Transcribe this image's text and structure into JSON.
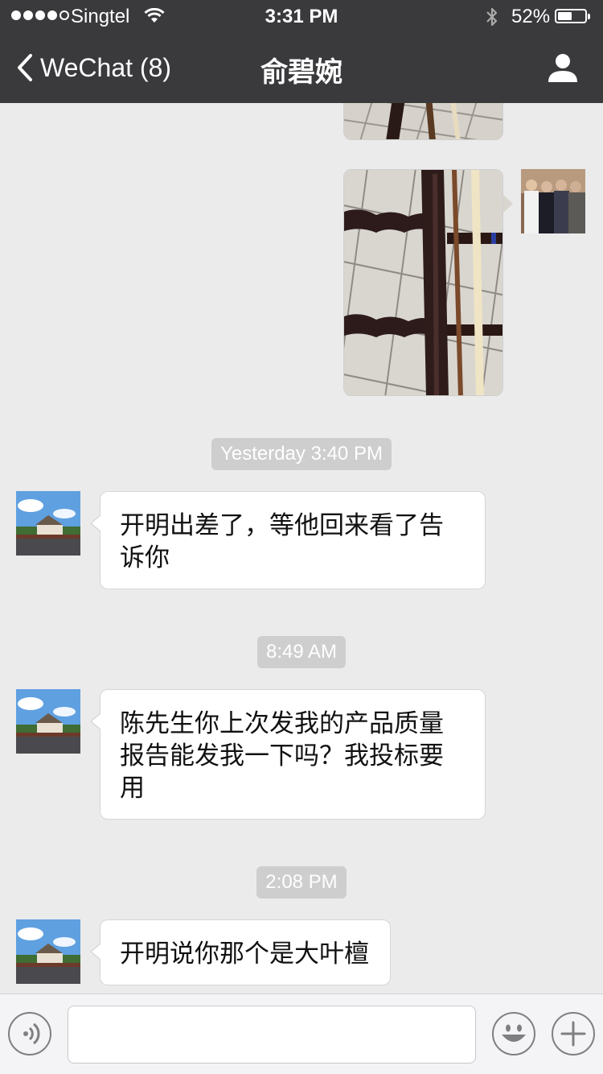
{
  "status_bar": {
    "carrier": "Singtel",
    "time": "3:31 PM",
    "battery_percent": "52%",
    "battery_level": 0.52,
    "signal_bars_filled": 4,
    "signal_bars_total": 5
  },
  "nav": {
    "back_label": "WeChat (8)",
    "title": "俞碧婉"
  },
  "messages": [
    {
      "type": "image",
      "direction": "outgoing",
      "description_icon": "photo-thumbnail"
    },
    {
      "type": "image",
      "direction": "outgoing",
      "description_icon": "photo-thumbnail"
    },
    {
      "type": "timestamp",
      "text": "Yesterday 3:40 PM"
    },
    {
      "type": "text",
      "direction": "incoming",
      "text": "开明出差了，等他回来看了告诉你"
    },
    {
      "type": "timestamp",
      "text": "8:49 AM"
    },
    {
      "type": "text",
      "direction": "incoming",
      "text": "陈先生你上次发我的产品质量报告能发我一下吗？我投标要用"
    },
    {
      "type": "timestamp",
      "text": "2:08 PM"
    },
    {
      "type": "text",
      "direction": "incoming",
      "text": "开明说你那个是大叶檀"
    }
  ],
  "input": {
    "value": "",
    "placeholder": ""
  },
  "icons": {
    "back": "chevron-left-icon",
    "profile": "person-icon",
    "voice": "voice-icon",
    "emoji": "emoji-icon",
    "plus": "plus-icon"
  },
  "colors": {
    "nav_bg": "#3a3a3d",
    "chat_bg": "#ebebeb",
    "timestamp_bg": "#cecece",
    "bubble_bg": "#ffffff"
  }
}
